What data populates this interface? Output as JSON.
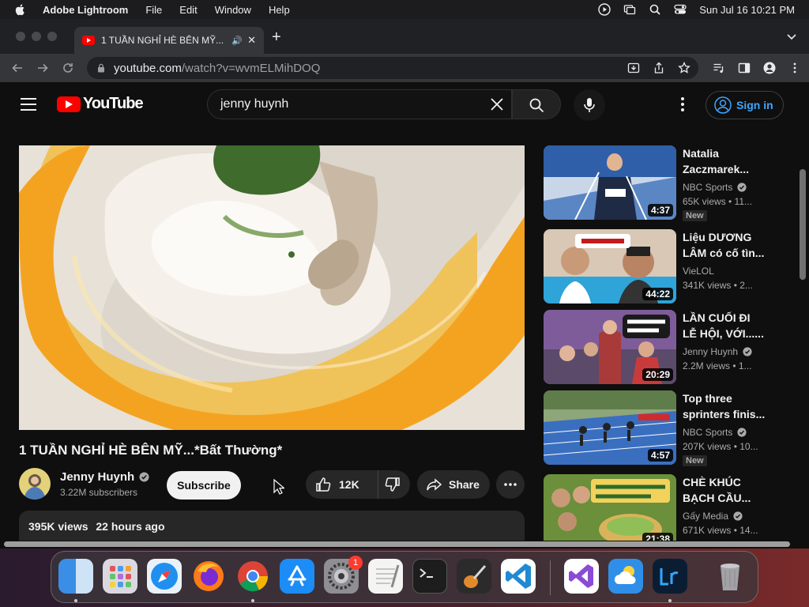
{
  "menubar": {
    "app_name": "Adobe Lightroom",
    "menus": [
      "File",
      "Edit",
      "Window",
      "Help"
    ],
    "clock": "Sun Jul 16  10:21 PM"
  },
  "browser": {
    "tab_title": "1 TUẦN NGHỈ HÈ BÊN MỸ...",
    "url_host": "youtube.com",
    "url_path": "/watch?v=wvmELMihDOQ"
  },
  "youtube": {
    "logo_text": "YouTube",
    "search_value": "jenny huynh",
    "sign_in_label": "Sign in",
    "video": {
      "title": "1 TUẦN NGHỈ HÈ BÊN MỸ...*Bất Thường*",
      "channel": "Jenny Huynh",
      "subscribers": "3.22M subscribers",
      "subscribe_label": "Subscribe",
      "likes": "12K",
      "share_label": "Share",
      "views": "395K views",
      "posted": "22 hours ago"
    },
    "recommendations": [
      {
        "title": "Natalia Zaczmarek...",
        "channel": "NBC Sports",
        "meta": "65K views  •  11...",
        "duration": "4:37",
        "badge": "New",
        "thumb_colors": [
          "#2e5fa8",
          "#b9c7db"
        ]
      },
      {
        "title": "Liệu DƯƠNG LÂM có cố tìn...",
        "channel": "VieLOL",
        "meta": "341K views  •  2...",
        "duration": "44:22",
        "badge": "",
        "thumb_colors": [
          "#c9b29a",
          "#2fa4d9"
        ]
      },
      {
        "title": "LẦN CUỐI ĐI LỄ HỘI, VỚI......",
        "channel": "Jenny Huynh",
        "meta": "2.2M views  •  1...",
        "duration": "20:29",
        "badge": "",
        "thumb_colors": [
          "#a93a3a",
          "#7e5c9a"
        ]
      },
      {
        "title": "Top three sprinters finis...",
        "channel": "NBC Sports",
        "meta": "207K views  •  10...",
        "duration": "4:57",
        "badge": "New",
        "thumb_colors": [
          "#3a6fc0",
          "#8fa57a"
        ]
      },
      {
        "title": "CHÈ KHÚC BẠCH CẦU...",
        "channel": "Gấy Media",
        "meta": "671K views  •  14...",
        "duration": "21:38",
        "badge": "",
        "thumb_colors": [
          "#6b8f3a",
          "#d8b35a"
        ]
      }
    ]
  },
  "dock": {
    "notification_badge": "1",
    "apps": [
      {
        "name": "finder-icon",
        "color": "#3a8ee6"
      },
      {
        "name": "launchpad-icon",
        "color": "#d9d9df"
      },
      {
        "name": "safari-icon",
        "color": "#e9f2fb"
      },
      {
        "name": "firefox-icon",
        "color": "#ff7a1a"
      },
      {
        "name": "chrome-icon",
        "color": "#f1f1f1"
      },
      {
        "name": "app-store-icon",
        "color": "#1c8cf6"
      },
      {
        "name": "system-settings-icon",
        "color": "#8e8e93"
      },
      {
        "name": "textedit-icon",
        "color": "#f4f4f2"
      },
      {
        "name": "terminal-icon",
        "color": "#1d1d1d"
      },
      {
        "name": "garageband-icon",
        "color": "#2b2b2b"
      },
      {
        "name": "vscode-icon",
        "color": "#ffffff"
      },
      {
        "name": "visual-studio-icon",
        "color": "#ffffff"
      },
      {
        "name": "weather-icon",
        "color": "#2f8fe8"
      },
      {
        "name": "lightroom-icon",
        "color": "#0b1d33"
      },
      {
        "name": "trash-icon",
        "color": "#9b9ba0"
      }
    ]
  }
}
